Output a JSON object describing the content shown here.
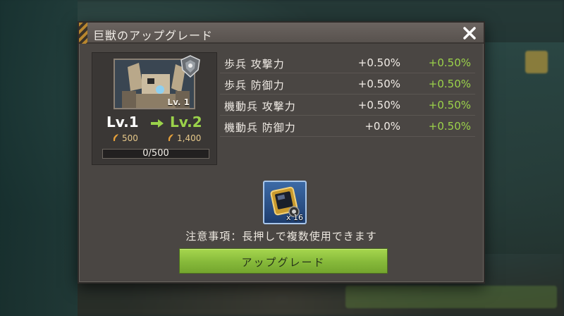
{
  "dialog": {
    "title": "巨獣のアップグレード"
  },
  "beast": {
    "portrait_level": "Lv. 1",
    "level_from": "Lv.1",
    "level_to": "Lv.2",
    "power_from": "500",
    "power_to": "1,400",
    "progress_text": "0/500",
    "progress_fraction": 0.0
  },
  "stats": [
    {
      "name": "歩兵 攻撃力",
      "current": "+0.50%",
      "next": "+0.50%"
    },
    {
      "name": "歩兵 防御力",
      "current": "+0.50%",
      "next": "+0.50%"
    },
    {
      "name": "機動兵 攻撃力",
      "current": "+0.50%",
      "next": "+0.50%"
    },
    {
      "name": "機動兵 防御力",
      "current": "+0.0%",
      "next": "+0.50%"
    }
  ],
  "item": {
    "icon": "upgrade-chip-icon",
    "count": "x 16"
  },
  "notice": "注意事項：長押しで複数使用できます",
  "upgrade_button": "アップグレード",
  "colors": {
    "accent_green": "#9bd24a",
    "panel": "#4a4643",
    "button": "#86b93a"
  }
}
